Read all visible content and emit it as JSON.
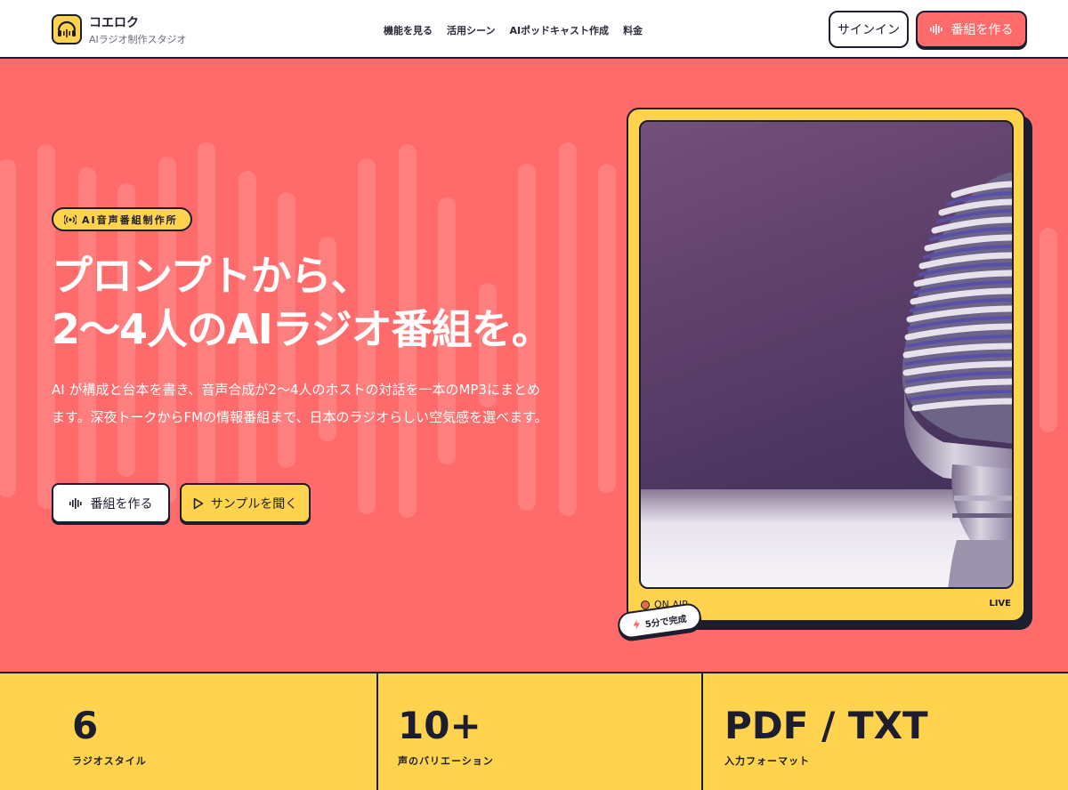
{
  "header": {
    "brand_name": "コエロク",
    "brand_sub": "AIラジオ制作スタジオ",
    "nav": [
      {
        "label": "機能を見る"
      },
      {
        "label": "活用シーン"
      },
      {
        "label": "AIポッドキャスト作成"
      },
      {
        "label": "料金"
      }
    ],
    "signin_label": "サインイン",
    "create_label": "番組を作る"
  },
  "hero": {
    "badge": "AI音声番組制作所",
    "headline_line1": "プロンプトから、",
    "headline_line2": "2〜4人のAIラジオ番組を。",
    "description": "AI が構成と台本を書き、音声合成が2〜4人のホストの対話を一本のMP3にまとめます。深夜トークからFMの情報番組まで、日本のラジオらしい空気感を選べます。",
    "create_button": "番組を作る",
    "sample_button": "サンプルを聞く"
  },
  "player": {
    "on_air": "ON AIR",
    "live": "LIVE",
    "pill": "5分で完成"
  },
  "stats": [
    {
      "value": "6",
      "label": "ラジオスタイル"
    },
    {
      "value": "10+",
      "label": "声のバリエーション"
    },
    {
      "value": "PDF / TXT",
      "label": "入力フォーマット"
    }
  ],
  "colors": {
    "hero_bg": "#ff6b6b",
    "accent_yellow": "#ffd34d",
    "ink": "#1c1d2e",
    "button_coral": "#ff6a6a"
  },
  "icons": {
    "logo": "headphones-wave-icon",
    "create": "waveform-icon",
    "sample": "play-icon",
    "badge": "broadcast-icon",
    "pill": "lightning-icon"
  }
}
